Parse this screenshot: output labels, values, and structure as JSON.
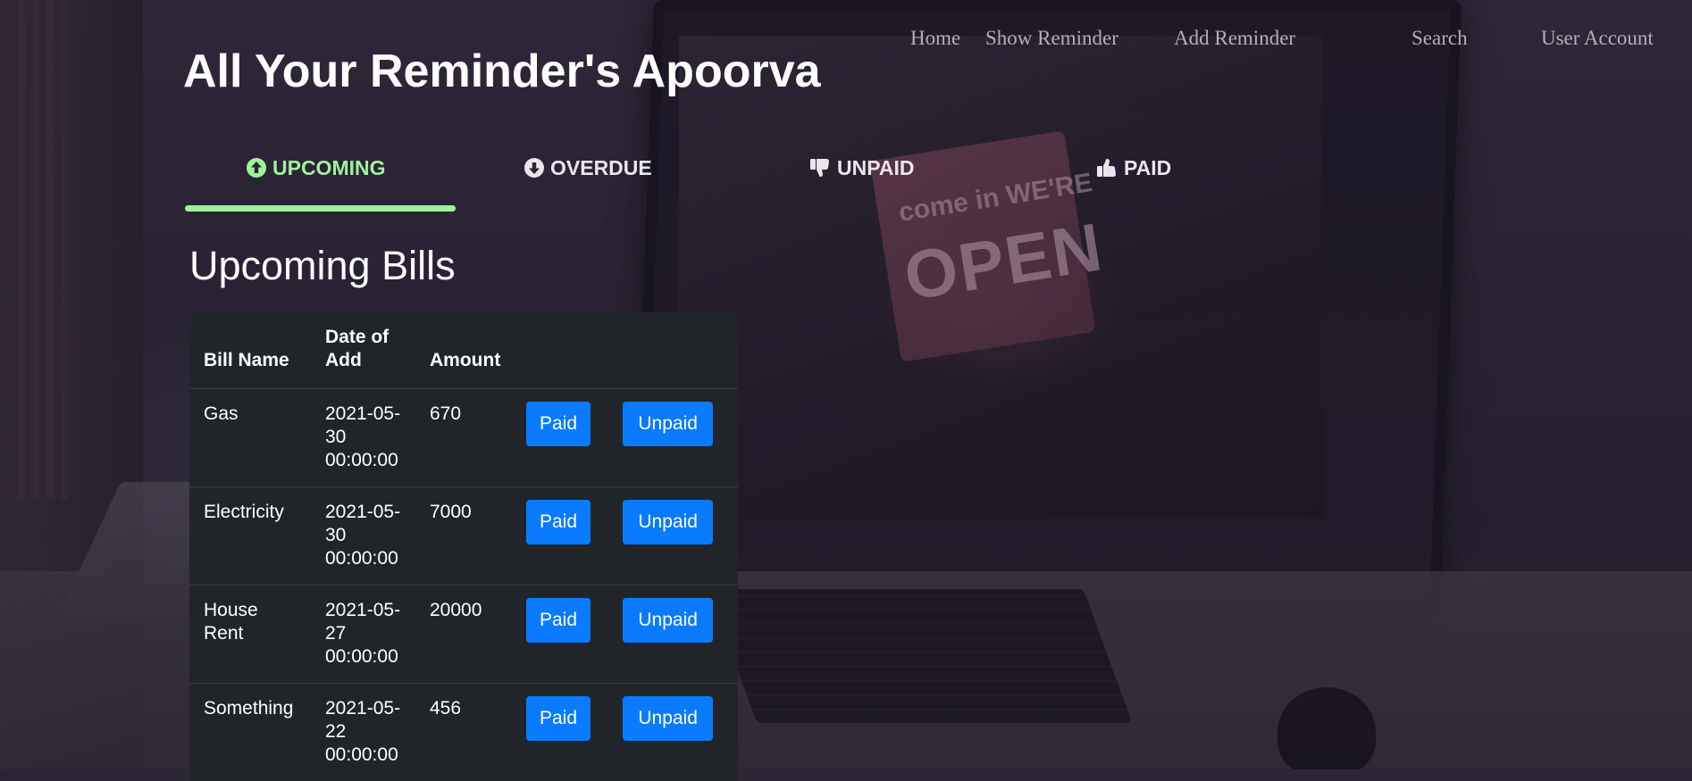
{
  "nav": {
    "items": [
      "Home",
      "Show Reminder",
      "Add Reminder",
      "Search",
      "User Account"
    ]
  },
  "page": {
    "title": "All Your Reminder's Apoorva"
  },
  "tabs": [
    {
      "label": "UPCOMING",
      "icon": "arrow-circle-up-icon",
      "active": true
    },
    {
      "label": "OVERDUE",
      "icon": "arrow-circle-down-icon",
      "active": false
    },
    {
      "label": "UNPAID",
      "icon": "thumbs-down-icon",
      "active": false
    },
    {
      "label": "PAID",
      "icon": "thumbs-up-icon",
      "active": false
    }
  ],
  "section": {
    "title": "Upcoming Bills"
  },
  "table": {
    "headers": [
      "Bill Name",
      "Date of Add",
      "Amount"
    ],
    "rows": [
      {
        "name": "Gas",
        "date": "2021-05-30 00:00:00",
        "amount": "670",
        "paid_label": "Paid",
        "unpaid_label": "Unpaid"
      },
      {
        "name": "Electricity",
        "date": "2021-05-30 00:00:00",
        "amount": "7000",
        "paid_label": "Paid",
        "unpaid_label": "Unpaid"
      },
      {
        "name": "House Rent",
        "date": "2021-05-27 00:00:00",
        "amount": "20000",
        "paid_label": "Paid",
        "unpaid_label": "Unpaid"
      },
      {
        "name": "Something",
        "date": "2021-05-22 00:00:00",
        "amount": "456",
        "paid_label": "Paid",
        "unpaid_label": "Unpaid"
      }
    ]
  },
  "colors": {
    "active_tab": "#9ef39a",
    "button": "#0a7bff",
    "table_bg": "#212529"
  }
}
